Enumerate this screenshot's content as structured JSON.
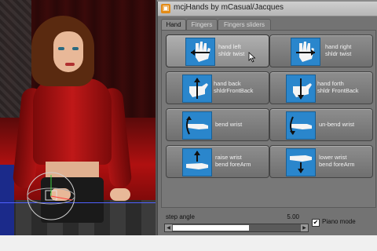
{
  "window": {
    "title": "mcjHands by mCasual/Jacques"
  },
  "tabs": [
    {
      "label": "Hand",
      "active": true
    },
    {
      "label": "Fingers",
      "active": false
    },
    {
      "label": "Fingers sliders",
      "active": false
    }
  ],
  "buttons": [
    {
      "line1": "hand left",
      "line2": "shldr twist",
      "icon": "hand-arrow-left-icon"
    },
    {
      "line1": "hand right",
      "line2": "shldr twist",
      "icon": "hand-arrow-right-icon"
    },
    {
      "line1": "hand back",
      "line2": "shldrFrontBack",
      "icon": "hand-arrow-up-icon"
    },
    {
      "line1": "hand forth",
      "line2": "shldr FrontBack",
      "icon": "hand-arrow-down-icon"
    },
    {
      "line1": "bend wrist",
      "line2": "",
      "icon": "wrist-bend-icon"
    },
    {
      "line1": "un-bend wrist",
      "line2": "",
      "icon": "wrist-unbend-icon"
    },
    {
      "line1": "raise wrist",
      "line2": "bend foreArm",
      "icon": "wrist-raise-icon"
    },
    {
      "line1": "lower wrist",
      "line2": "bend foreArm",
      "icon": "wrist-lower-icon"
    }
  ],
  "step": {
    "label": "step angle",
    "value": "5.00",
    "slider_position": 0.6
  },
  "piano_mode": {
    "label": "Piano mode",
    "checked": true,
    "check_glyph": "✔"
  },
  "colors": {
    "dialog_bg": "#737373",
    "thumb_blue": "#2a86cc",
    "shirt_red": "#c01818"
  }
}
